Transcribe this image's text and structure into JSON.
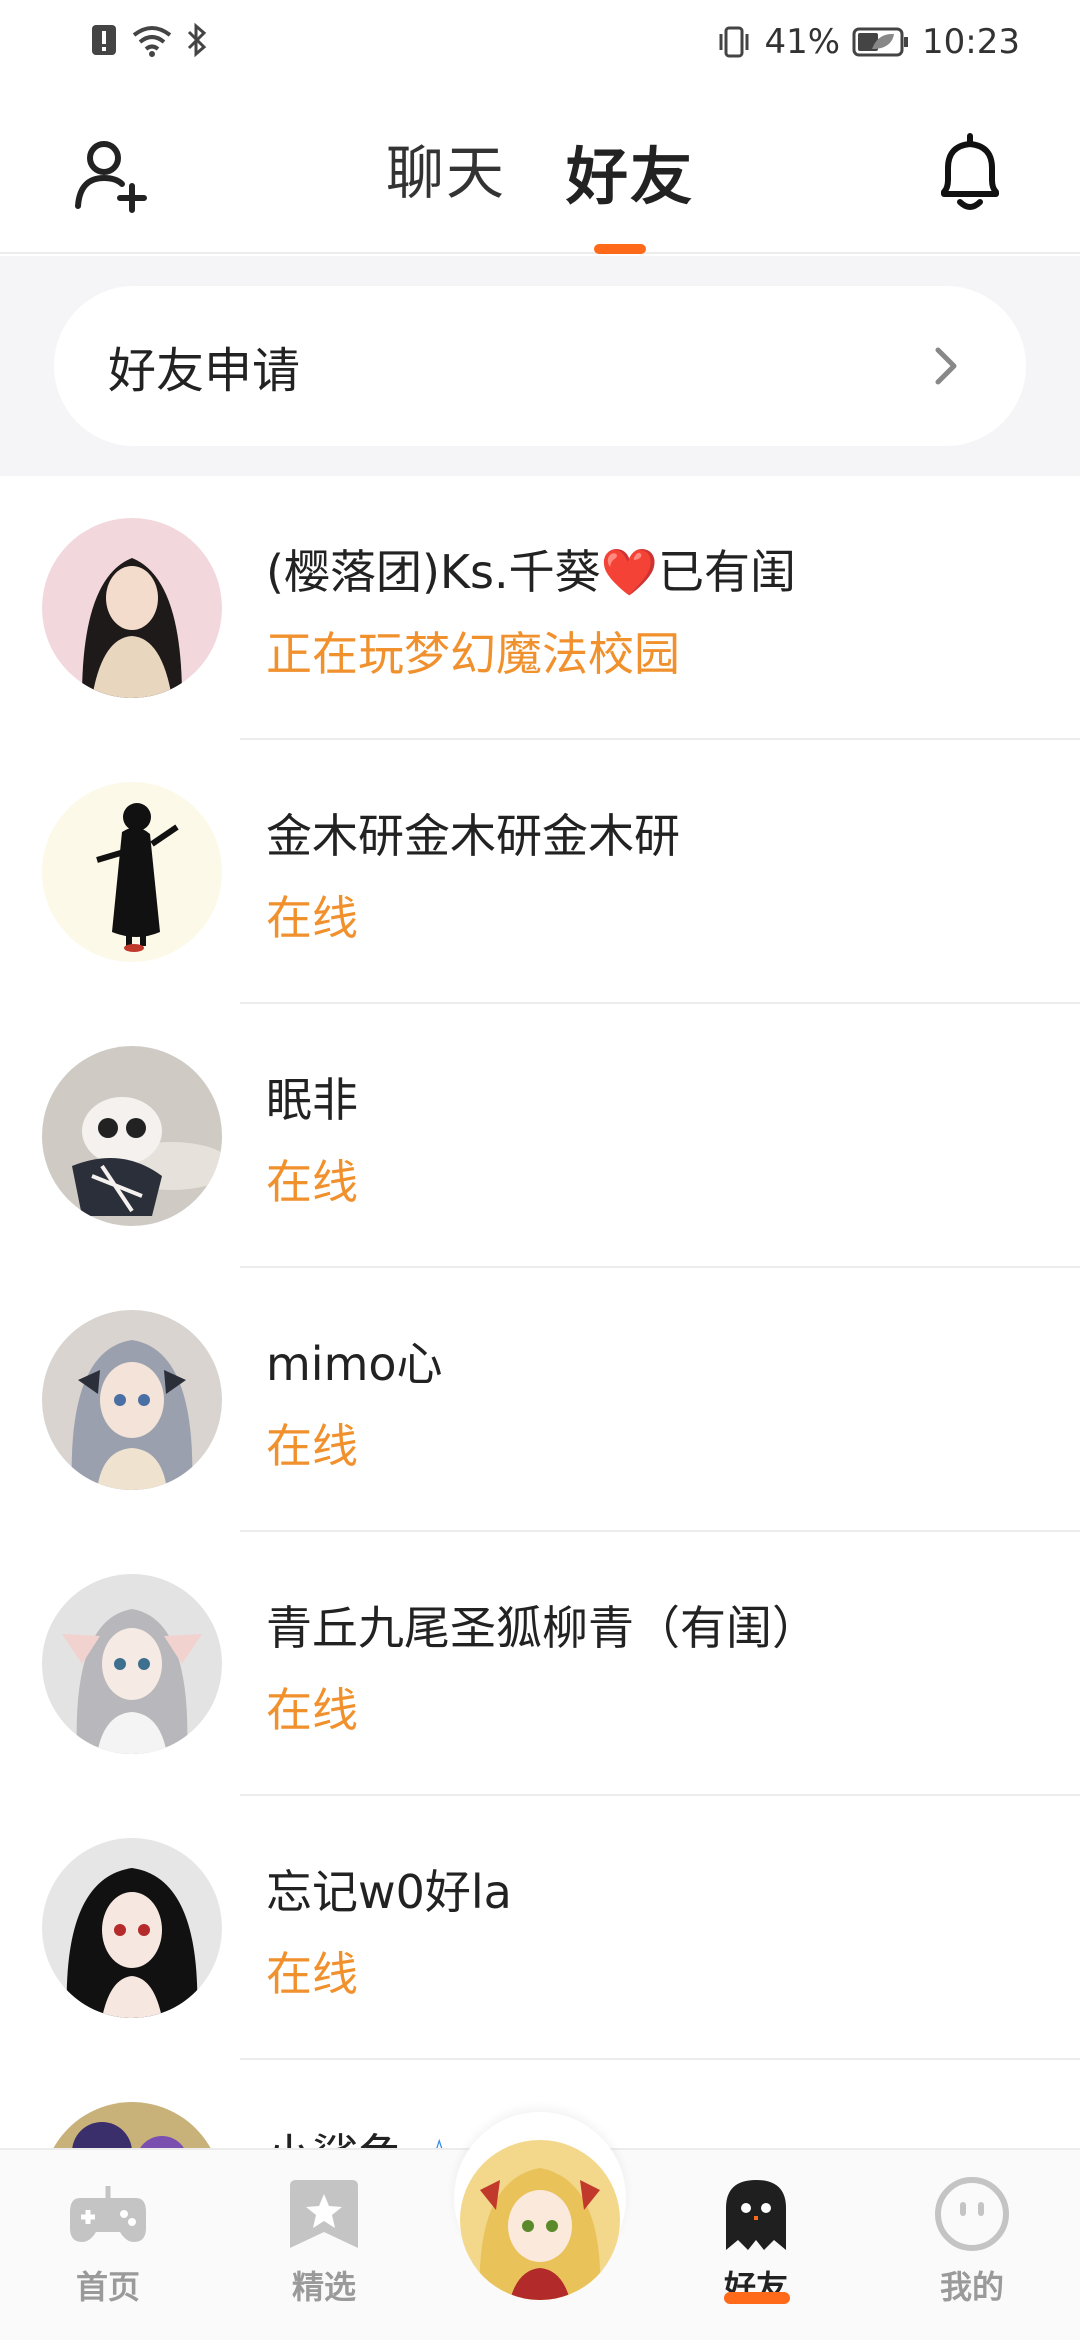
{
  "status_bar": {
    "battery": "41%",
    "time": "10:23"
  },
  "header": {
    "tabs": [
      {
        "label": "聊天",
        "active": false
      },
      {
        "label": "好友",
        "active": true
      }
    ],
    "accent_color": "#ff6a1a"
  },
  "friend_request": {
    "label": "好友申请"
  },
  "friends": [
    {
      "name_pre": "(樱落团)Ks.千葵",
      "name_emoji": "❤️",
      "name_post": "已有闺",
      "status": "正在玩梦幻魔法校园",
      "avatar_color": "#f2d8dc"
    },
    {
      "name": "金木研金木研金木研",
      "status": "在线",
      "avatar_color": "#fdf9e8"
    },
    {
      "name": "眠非",
      "status": "在线",
      "avatar_color": "#cfcac4"
    },
    {
      "name": "mimo心",
      "status": "在线",
      "avatar_color": "#d9d4cf"
    },
    {
      "name": "青丘九尾圣狐柳青（有闺）",
      "status": "在线",
      "avatar_color": "#e3e3e3"
    },
    {
      "name": "忘记w0好la",
      "status": "在线",
      "avatar_color": "#e6e6e6"
    },
    {
      "name": "小鲨鱼",
      "status": "",
      "avatar_color": "#c9b27a"
    }
  ],
  "bottom_nav": [
    {
      "label": "首页",
      "icon": "gamepad-icon",
      "active": false
    },
    {
      "label": "精选",
      "icon": "star-bookmark-icon",
      "active": false
    },
    {
      "label": "",
      "icon": "avatar-center",
      "active": false
    },
    {
      "label": "好友",
      "icon": "ghost-icon",
      "active": true
    },
    {
      "label": "我的",
      "icon": "face-icon",
      "active": false
    }
  ],
  "status_color": "#f0912e"
}
